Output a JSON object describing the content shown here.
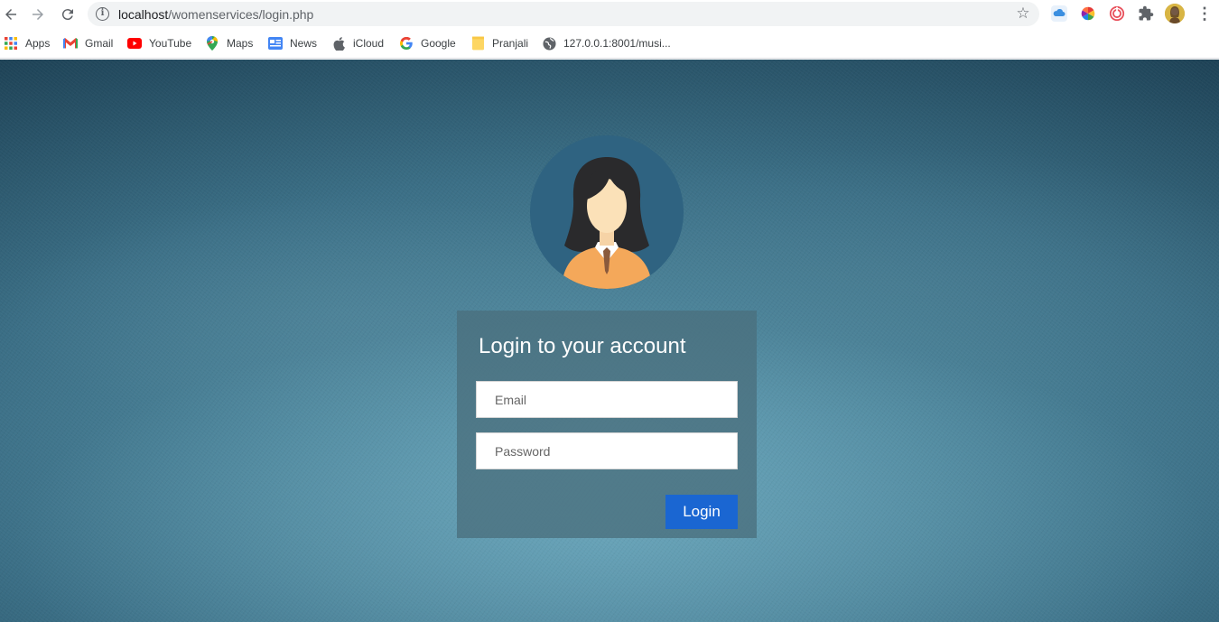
{
  "browser": {
    "url_host": "localhost",
    "url_path": "/womenservices/login.php",
    "bookmarks": [
      {
        "label": "Apps",
        "icon": "apps-grid-icon"
      },
      {
        "label": "Gmail",
        "icon": "gmail-icon"
      },
      {
        "label": "YouTube",
        "icon": "youtube-icon"
      },
      {
        "label": "Maps",
        "icon": "maps-icon"
      },
      {
        "label": "News",
        "icon": "news-icon"
      },
      {
        "label": "iCloud",
        "icon": "apple-icon"
      },
      {
        "label": "Google",
        "icon": "google-icon"
      },
      {
        "label": "Pranjali",
        "icon": "folder-icon"
      },
      {
        "label": "127.0.0.1:8001/musi...",
        "icon": "globe-icon"
      }
    ]
  },
  "login": {
    "title": "Login to your account",
    "email_placeholder": "Email",
    "password_placeholder": "Password",
    "submit_label": "Login"
  },
  "colors": {
    "button": "#1a66d2",
    "panel": "#4a707e",
    "avatar_bg": "#2f6381"
  }
}
